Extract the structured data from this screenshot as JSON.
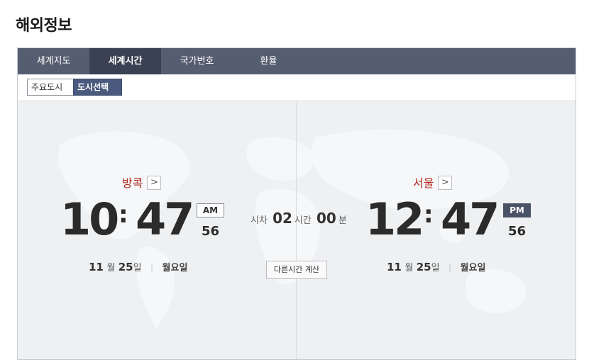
{
  "page": {
    "title": "해외정보"
  },
  "tabs": [
    {
      "label": "세계지도"
    },
    {
      "label": "세계시간"
    },
    {
      "label": "국가번호"
    },
    {
      "label": "환율"
    }
  ],
  "subtabs": [
    {
      "label": "주요도시"
    },
    {
      "label": "도시선택"
    }
  ],
  "left_city": {
    "name": "방콕",
    "arrow": ">",
    "hour": "10",
    "minute": "47",
    "colon": ":",
    "ampm": "AM",
    "seconds": "56",
    "month": "11",
    "month_unit": "월",
    "day": "25",
    "day_unit": "일",
    "weekday": "월요일"
  },
  "right_city": {
    "name": "서울",
    "arrow": ">",
    "hour": "12",
    "minute": "47",
    "colon": ":",
    "ampm": "PM",
    "seconds": "56",
    "month": "11",
    "month_unit": "월",
    "day": "25",
    "day_unit": "일",
    "weekday": "월요일"
  },
  "difference": {
    "prefix": "시차",
    "hours": "02",
    "hours_unit": "시간",
    "minutes": "00",
    "minutes_unit": "분"
  },
  "calc_button": {
    "label": "다른시간 계산"
  },
  "colors": {
    "tab_bg": "#555d70",
    "tab_active": "#3a4152",
    "city_name": "#b32a23",
    "pm_badge": "#4a5268"
  }
}
